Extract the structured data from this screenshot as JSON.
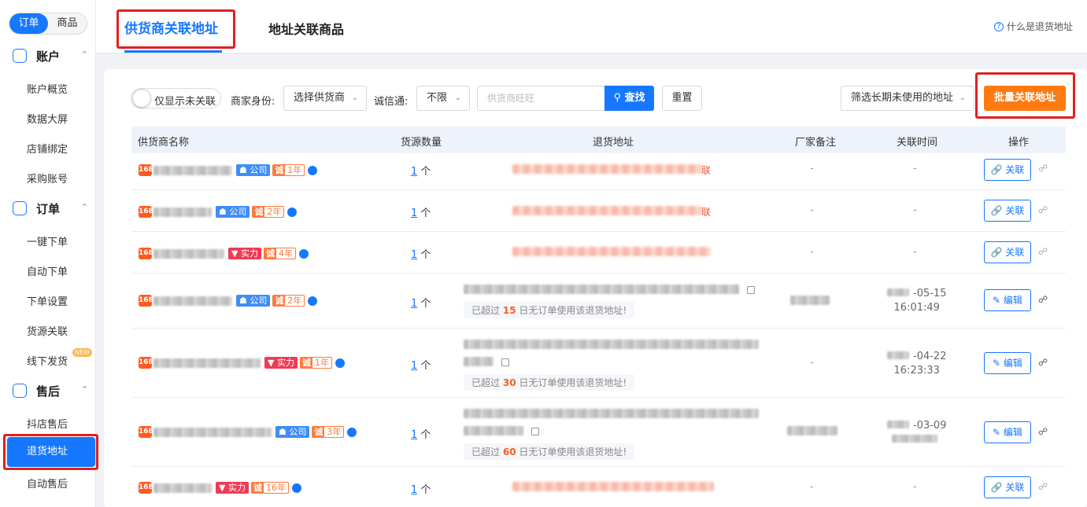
{
  "sidebar": {
    "seg": [
      "订单",
      "商品"
    ],
    "groups": [
      {
        "title": "账户",
        "items": [
          "账户概览",
          "数据大屏",
          "店铺绑定",
          "采购账号"
        ]
      },
      {
        "title": "订单",
        "items": [
          "一键下单",
          "自动下单",
          "下单设置",
          "货源关联",
          "线下发货"
        ]
      },
      {
        "title": "售后",
        "items": [
          "抖店售后",
          "退货地址",
          "自动售后"
        ]
      }
    ],
    "new_badge": "NEW"
  },
  "tabs": {
    "tab1": "供货商关联地址",
    "tab2": "地址关联商品",
    "help": "什么是退货地址"
  },
  "filters": {
    "toggle_label": "仅显示未关联",
    "identity_label": "商家身份:",
    "identity_value": "选择供货商",
    "chengxin_label": "诚信通:",
    "chengxin_value": "不限",
    "search_placeholder": "供货商旺旺",
    "search_btn": "查找",
    "reset_btn": "重置",
    "unused_select": "筛选长期未使用的地址",
    "batch_btn": "批量关联地址"
  },
  "table": {
    "headers": [
      "供货商名称",
      "货源数量",
      "退货地址",
      "厂家备注",
      "关联时间",
      "操作"
    ],
    "rows": [
      {
        "tag": "公司",
        "years": "1年",
        "count": "1",
        "unit": "个",
        "addr_suffix": "联",
        "note": "-",
        "time1": "-",
        "time2": "",
        "warn_pre": "",
        "days": "",
        "warn_post": "",
        "op": "关联"
      },
      {
        "tag": "公司",
        "years": "2年",
        "count": "1",
        "unit": "个",
        "addr_suffix": "联",
        "note": "-",
        "time1": "-",
        "time2": "",
        "warn_pre": "",
        "days": "",
        "warn_post": "",
        "op": "关联"
      },
      {
        "tag": "实力",
        "years": "4年",
        "count": "1",
        "unit": "个",
        "addr_suffix": "",
        "note": "-",
        "time1": "-",
        "time2": "",
        "warn_pre": "",
        "days": "",
        "warn_post": "",
        "op": "关联"
      },
      {
        "tag": "公司",
        "years": "2年",
        "count": "1",
        "unit": "个",
        "addr_suffix": "",
        "note": "",
        "time1": "-05-15",
        "time2": "16:01:49",
        "warn_pre": "已超过",
        "days": "15",
        "warn_post": "日无订单使用该退货地址!",
        "op": "编辑"
      },
      {
        "tag": "实力",
        "years": "1年",
        "count": "1",
        "unit": "个",
        "addr_suffix": "",
        "note": "-",
        "time1": "-04-22",
        "time2": "16:23:33",
        "warn_pre": "已超过",
        "days": "30",
        "warn_post": "日无订单使用该退货地址!",
        "op": "编辑"
      },
      {
        "tag": "公司",
        "years": "3年",
        "count": "1",
        "unit": "个",
        "addr_suffix": "",
        "note": "",
        "time1": "-03-09",
        "time2": "",
        "warn_pre": "已超过",
        "days": "60",
        "warn_post": "日无订单使用该退货地址!",
        "op": "编辑"
      },
      {
        "tag": "实力",
        "years": "16年",
        "count": "1",
        "unit": "个",
        "addr_suffix": "",
        "note": "-",
        "time1": "-",
        "time2": "",
        "warn_pre": "",
        "days": "",
        "warn_post": "",
        "op": "关联"
      }
    ]
  },
  "colors": {
    "primary": "#1677ff",
    "orange": "#ff7a10",
    "highlight_box": "#e02020"
  }
}
